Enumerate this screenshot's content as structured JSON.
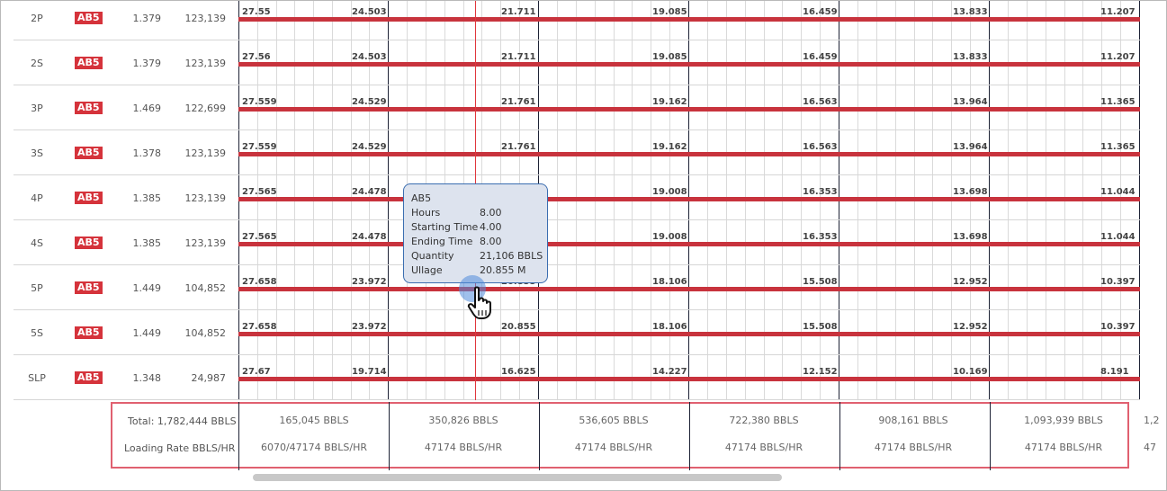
{
  "rows": [
    {
      "name": "2P",
      "grade": "AB5",
      "rate": "1.379",
      "capacity": "123,139",
      "values": [
        "27.55",
        "24.503",
        "21.711",
        "19.085",
        "16.459",
        "13.833",
        "11.207"
      ]
    },
    {
      "name": "2S",
      "grade": "AB5",
      "rate": "1.379",
      "capacity": "123,139",
      "values": [
        "27.56",
        "24.503",
        "21.711",
        "19.085",
        "16.459",
        "13.833",
        "11.207"
      ]
    },
    {
      "name": "3P",
      "grade": "AB5",
      "rate": "1.469",
      "capacity": "122,699",
      "values": [
        "27.559",
        "24.529",
        "21.761",
        "19.162",
        "16.563",
        "13.964",
        "11.365"
      ]
    },
    {
      "name": "3S",
      "grade": "AB5",
      "rate": "1.378",
      "capacity": "123,139",
      "values": [
        "27.559",
        "24.529",
        "21.761",
        "19.162",
        "16.563",
        "13.964",
        "11.365"
      ]
    },
    {
      "name": "4P",
      "grade": "AB5",
      "rate": "1.385",
      "capacity": "123,139",
      "values": [
        "27.565",
        "24.478",
        "",
        "19.008",
        "16.353",
        "13.698",
        "11.044"
      ]
    },
    {
      "name": "4S",
      "grade": "AB5",
      "rate": "1.385",
      "capacity": "123,139",
      "values": [
        "27.565",
        "24.478",
        "",
        "19.008",
        "16.353",
        "13.698",
        "11.044"
      ]
    },
    {
      "name": "5P",
      "grade": "AB5",
      "rate": "1.449",
      "capacity": "104,852",
      "values": [
        "27.658",
        "23.972",
        "20.855",
        "18.106",
        "15.508",
        "12.952",
        "10.397"
      ]
    },
    {
      "name": "5S",
      "grade": "AB5",
      "rate": "1.449",
      "capacity": "104,852",
      "values": [
        "27.658",
        "23.972",
        "20.855",
        "18.106",
        "15.508",
        "12.952",
        "10.397"
      ]
    },
    {
      "name": "SLP",
      "grade": "AB5",
      "rate": "1.348",
      "capacity": "24,987",
      "values": [
        "27.67",
        "19.714",
        "16.625",
        "14.227",
        "12.152",
        "10.169",
        "8.191"
      ]
    }
  ],
  "totals": {
    "total_label": "Total: 1,782,444 BBLS",
    "rate_label": "Loading Rate BBLS/HR",
    "quantities": [
      "165,045 BBLS",
      "350,826 BBLS",
      "536,605 BBLS",
      "722,380 BBLS",
      "908,161 BBLS",
      "1,093,939 BBLS"
    ],
    "rates": [
      "6070/47174 BBLS/HR",
      "47174 BBLS/HR",
      "47174 BBLS/HR",
      "47174 BBLS/HR",
      "47174 BBLS/HR",
      "47174 BBLS/HR"
    ],
    "overflow_quantity": "1,2",
    "overflow_rate": "47"
  },
  "tooltip": {
    "title": "AB5",
    "rows": [
      {
        "label": "Hours",
        "value": "8.00"
      },
      {
        "label": "Starting Time",
        "value": "4.00"
      },
      {
        "label": "Ending Time",
        "value": "8.00"
      },
      {
        "label": "Quantity",
        "value": "21,106 BBLS"
      },
      {
        "label": "Ullage",
        "value": "20.855 M"
      }
    ]
  },
  "colors": {
    "bar": "#c8333d",
    "badge": "#d5333b",
    "highlight_border": "#e06070",
    "current_time_line": "#e0363c"
  }
}
